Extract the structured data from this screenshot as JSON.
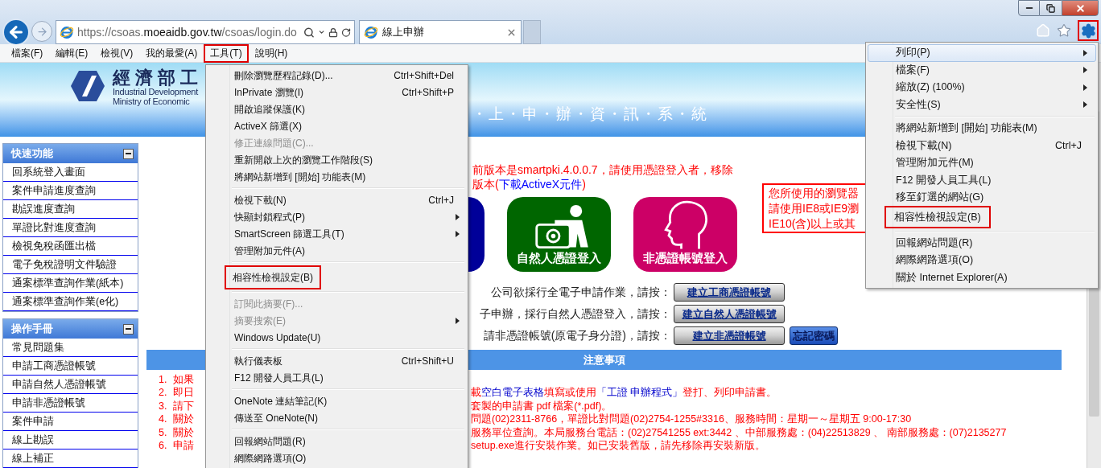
{
  "address": {
    "prefix": "https://csoas.",
    "domain": "moeaidb.gov.tw",
    "path": "/csoas/login.do"
  },
  "tabs": [
    {
      "title": "線上申辦",
      "selected": true
    }
  ],
  "toolbar": {
    "settings_highlighted": true
  },
  "menubar": [
    {
      "label": "檔案(F)",
      "highlighted": false
    },
    {
      "label": "編輯(E)",
      "highlighted": false
    },
    {
      "label": "檢視(V)",
      "highlighted": false
    },
    {
      "label": "我的最愛(A)",
      "highlighted": false
    },
    {
      "label": "工具(T)",
      "highlighted": true
    },
    {
      "label": "說明(H)",
      "highlighted": false
    }
  ],
  "banner": {
    "title": "經 濟 部 工",
    "subtitle_1": "Industrial Development",
    "subtitle_2": "Ministry of Economic",
    "tagline": "・上・申・辦・資・訊・系・統"
  },
  "sidebar": [
    {
      "title": "快速功能",
      "items": [
        "回系統登入畫面",
        "案件申請進度查詢",
        "勘誤進度查詢",
        "單證比對進度查詢",
        "檢視免稅函匯出檔",
        "電子免稅證明文件驗證",
        "通案標準查詢作業(紙本)",
        "通案標準查詢作業(e化)"
      ]
    },
    {
      "title": "操作手冊",
      "items": [
        "常見問題集",
        "申請工商憑證帳號",
        "申請自然人憑證帳號",
        "申請非憑證帳號",
        "案件申請",
        "線上勘誤",
        "線上補正"
      ]
    }
  ],
  "main": {
    "version_line": "前版本是smartpki.4.0.0.7，請使用憑證登入者，移除",
    "version_line_2": "版本(",
    "download_link": "下載ActiveX元件",
    "version_line_2_end": ")",
    "login_tiles": [
      {
        "kind": "covered",
        "color": "#000099"
      },
      {
        "kind": "card",
        "label": "自然人憑證登入",
        "color": "#006600"
      },
      {
        "kind": "head",
        "label": "非憑證帳號登入",
        "color": "#cc0066"
      }
    ],
    "browser_notice": [
      "您所使用的瀏覽器",
      "請使用IE8或IE9瀏",
      "IE10(含)以上或其"
    ],
    "account_rows": [
      {
        "prompt": "公司欲採行全電子申請作業，請按：",
        "buttons": [
          {
            "label": "建立工商憑證帳號",
            "kind": "gray"
          }
        ]
      },
      {
        "prompt": "子申辦，採行自然人憑證登入，請按：",
        "buttons": [
          {
            "label": "建立自然人憑證帳號",
            "kind": "gray"
          }
        ]
      },
      {
        "prompt": "請非憑證帳號(原電子身分證)，請按：",
        "buttons": [
          {
            "label": "建立非憑證帳號",
            "kind": "gray"
          },
          {
            "label": "忘記密碼",
            "kind": "blue"
          }
        ]
      }
    ],
    "notice": {
      "title": "注意事項",
      "items": [
        {
          "number": "1.",
          "head": "如果"
        },
        {
          "number": "2.",
          "head": "即日",
          "tail": [
            {
              "text": "載",
              "link": false
            },
            {
              "text": "空白電子表格",
              "link": true
            },
            {
              "text": "填寫或使用",
              "link": false
            },
            {
              "text": "「工證 申辦程式」",
              "link": true
            },
            {
              "text": "登打、列印申請書。",
              "link": false
            }
          ]
        },
        {
          "number": "3.",
          "head": "請下",
          "tail": [
            {
              "text": "套製的申請書 pdf 檔案(*.pdf)。",
              "link": false
            }
          ]
        },
        {
          "number": "4.",
          "head": "關於",
          "tail": [
            {
              "text": "問題(02)2311-8766，單證比對問題(02)2754-1255#3316、服務時間：星期一～星期五 9:00-17:30",
              "link": false
            }
          ]
        },
        {
          "number": "5.",
          "head": "關於",
          "tail": [
            {
              "text": "服務單位查詢。本局服務台電話：(02)27541255 ext:3442 、中部服務處：(04)22513829 、 南部服務處：(07)2135277",
              "link": false
            }
          ]
        },
        {
          "number": "6.",
          "head": "申請",
          "tail": [
            {
              "text": "setup.exe進行安裝作業。如已安裝舊版，請先移除再安裝新版。",
              "link": false
            }
          ]
        }
      ]
    }
  },
  "tools_menu": {
    "items": [
      {
        "kind": "item",
        "label": "刪除瀏覽歷程記錄(D)...",
        "shortcut": "Ctrl+Shift+Del",
        "submenu": false,
        "disabled": false,
        "highlighted": false
      },
      {
        "kind": "item",
        "label": "InPrivate 瀏覽(I)",
        "shortcut": "Ctrl+Shift+P",
        "submenu": false,
        "disabled": false,
        "highlighted": false
      },
      {
        "kind": "item",
        "label": "開啟追蹤保護(K)",
        "submenu": false,
        "disabled": false,
        "highlighted": false
      },
      {
        "kind": "item",
        "label": "ActiveX 篩選(X)",
        "submenu": false,
        "disabled": false,
        "highlighted": false
      },
      {
        "kind": "item",
        "label": "修正連線問題(C)...",
        "submenu": false,
        "disabled": true,
        "highlighted": false
      },
      {
        "kind": "item",
        "label": "重新開啟上次的瀏覽工作階段(S)",
        "submenu": false,
        "disabled": false,
        "highlighted": false
      },
      {
        "kind": "item",
        "label": "將網站新增到 [開始] 功能表(M)",
        "submenu": false,
        "disabled": false,
        "highlighted": false
      },
      {
        "kind": "separator"
      },
      {
        "kind": "item",
        "label": "檢視下載(N)",
        "shortcut": "Ctrl+J",
        "submenu": false,
        "disabled": false,
        "highlighted": false
      },
      {
        "kind": "item",
        "label": "快顯封鎖程式(P)",
        "submenu": true,
        "disabled": false,
        "highlighted": false
      },
      {
        "kind": "item",
        "label": "SmartScreen 篩選工具(T)",
        "submenu": true,
        "disabled": false,
        "highlighted": false
      },
      {
        "kind": "item",
        "label": "管理附加元件(A)",
        "submenu": false,
        "disabled": false,
        "highlighted": false
      },
      {
        "kind": "separator"
      },
      {
        "kind": "item",
        "label": "相容性檢視設定(B)",
        "submenu": false,
        "disabled": false,
        "highlighted": true
      },
      {
        "kind": "separator"
      },
      {
        "kind": "item",
        "label": "訂閱此摘要(F)...",
        "submenu": false,
        "disabled": true,
        "highlighted": false
      },
      {
        "kind": "item",
        "label": "摘要搜索(E)",
        "submenu": true,
        "disabled": true,
        "highlighted": false
      },
      {
        "kind": "item",
        "label": "Windows Update(U)",
        "submenu": false,
        "disabled": false,
        "highlighted": false
      },
      {
        "kind": "separator"
      },
      {
        "kind": "item",
        "label": "執行儀表板",
        "shortcut": "Ctrl+Shift+U",
        "submenu": false,
        "disabled": false,
        "highlighted": false
      },
      {
        "kind": "item",
        "label": "F12 開發人員工具(L)",
        "submenu": false,
        "disabled": false,
        "highlighted": false
      },
      {
        "kind": "separator"
      },
      {
        "kind": "item",
        "label": "OneNote 連結筆記(K)",
        "submenu": false,
        "disabled": false,
        "highlighted": false
      },
      {
        "kind": "item",
        "label": "傳送至 OneNote(N)",
        "submenu": false,
        "disabled": false,
        "highlighted": false
      },
      {
        "kind": "separator"
      },
      {
        "kind": "item",
        "label": "回報網站問題(R)",
        "submenu": false,
        "disabled": false,
        "highlighted": false
      },
      {
        "kind": "item",
        "label": "網際網路選項(O)",
        "submenu": false,
        "disabled": false,
        "highlighted": false
      }
    ]
  },
  "gear_menu": {
    "items": [
      {
        "kind": "item",
        "label": "列印(P)",
        "submenu": true,
        "selected": true,
        "highlighted": false
      },
      {
        "kind": "item",
        "label": "檔案(F)",
        "submenu": true,
        "selected": false,
        "highlighted": false
      },
      {
        "kind": "item",
        "label": "縮放(Z) (100%)",
        "submenu": true,
        "selected": false,
        "highlighted": false
      },
      {
        "kind": "item",
        "label": "安全性(S)",
        "submenu": true,
        "selected": false,
        "highlighted": false
      },
      {
        "kind": "separator"
      },
      {
        "kind": "item",
        "label": "將網站新增到 [開始] 功能表(M)",
        "submenu": false,
        "selected": false,
        "highlighted": false
      },
      {
        "kind": "item",
        "label": "檢視下載(N)",
        "shortcut": "Ctrl+J",
        "submenu": false,
        "selected": false,
        "highlighted": false
      },
      {
        "kind": "item",
        "label": "管理附加元件(M)",
        "submenu": false,
        "selected": false,
        "highlighted": false
      },
      {
        "kind": "item",
        "label": "F12 開發人員工具(L)",
        "submenu": false,
        "selected": false,
        "highlighted": false
      },
      {
        "kind": "item",
        "label": "移至釘選的網站(G)",
        "submenu": false,
        "selected": false,
        "highlighted": false
      },
      {
        "kind": "item",
        "label": "相容性檢視設定(B)",
        "submenu": false,
        "selected": false,
        "highlighted": true
      },
      {
        "kind": "separator"
      },
      {
        "kind": "item",
        "label": "回報網站問題(R)",
        "submenu": false,
        "selected": false,
        "highlighted": false
      },
      {
        "kind": "item",
        "label": "網際網路選項(O)",
        "submenu": false,
        "selected": false,
        "highlighted": false
      },
      {
        "kind": "item",
        "label": "關於 Internet Explorer(A)",
        "submenu": false,
        "selected": false,
        "highlighted": false
      }
    ]
  }
}
